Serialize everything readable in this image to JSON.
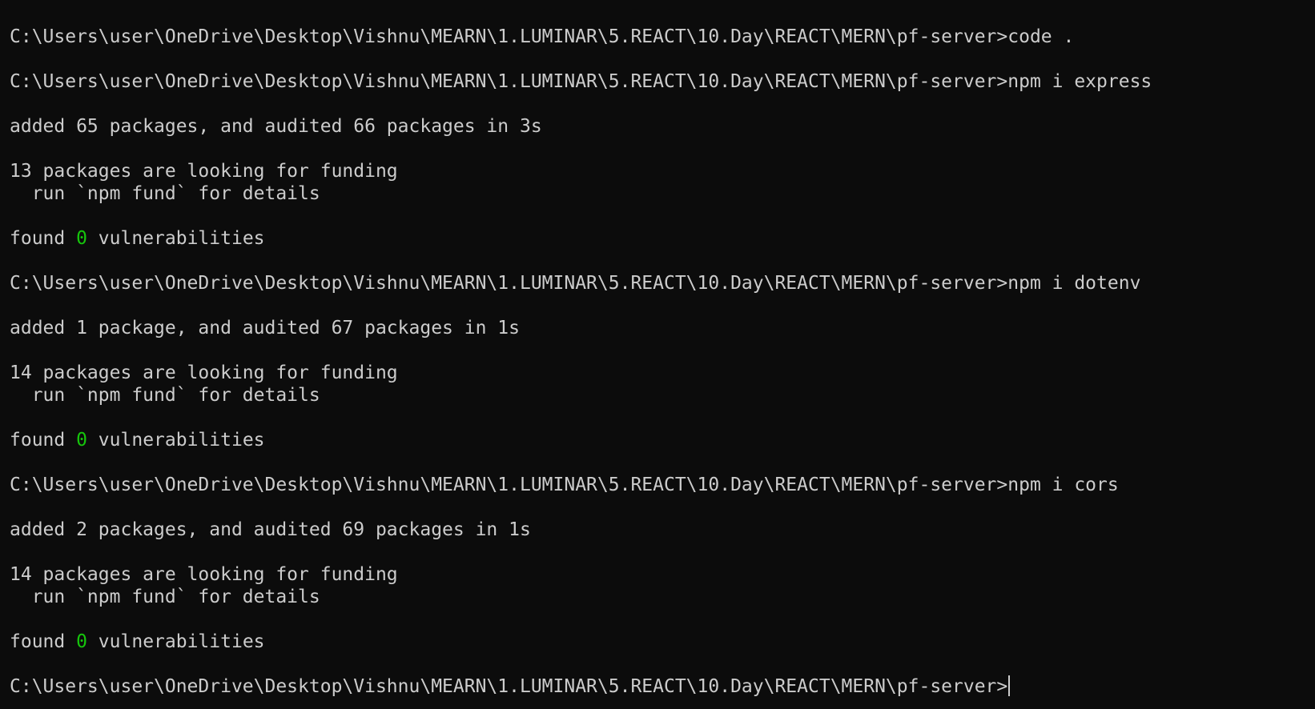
{
  "terminal": {
    "prompt": "C:\\Users\\user\\OneDrive\\Desktop\\Vishnu\\MEARN\\1.LUMINAR\\5.REACT\\10.Day\\REACT\\MERN\\pf-server>",
    "colors": {
      "background": "#0c0c0c",
      "text": "#cccccc",
      "zero_highlight": "#16c60c"
    },
    "blocks": [
      {
        "command": "code .",
        "output": []
      },
      {
        "command": "npm i express",
        "output": [
          "added 65 packages, and audited 66 packages in 3s",
          "13 packages are looking for funding",
          "  run `npm fund` for details"
        ],
        "found": {
          "prefix": "found ",
          "count": "0",
          "suffix": " vulnerabilities"
        }
      },
      {
        "command": "npm i dotenv",
        "output": [
          "added 1 package, and audited 67 packages in 1s",
          "14 packages are looking for funding",
          "  run `npm fund` for details"
        ],
        "found": {
          "prefix": "found ",
          "count": "0",
          "suffix": " vulnerabilities"
        }
      },
      {
        "command": "npm i cors",
        "output": [
          "added 2 packages, and audited 69 packages in 1s",
          "14 packages are looking for funding",
          "  run `npm fund` for details"
        ],
        "found": {
          "prefix": "found ",
          "count": "0",
          "suffix": " vulnerabilities"
        }
      }
    ]
  }
}
